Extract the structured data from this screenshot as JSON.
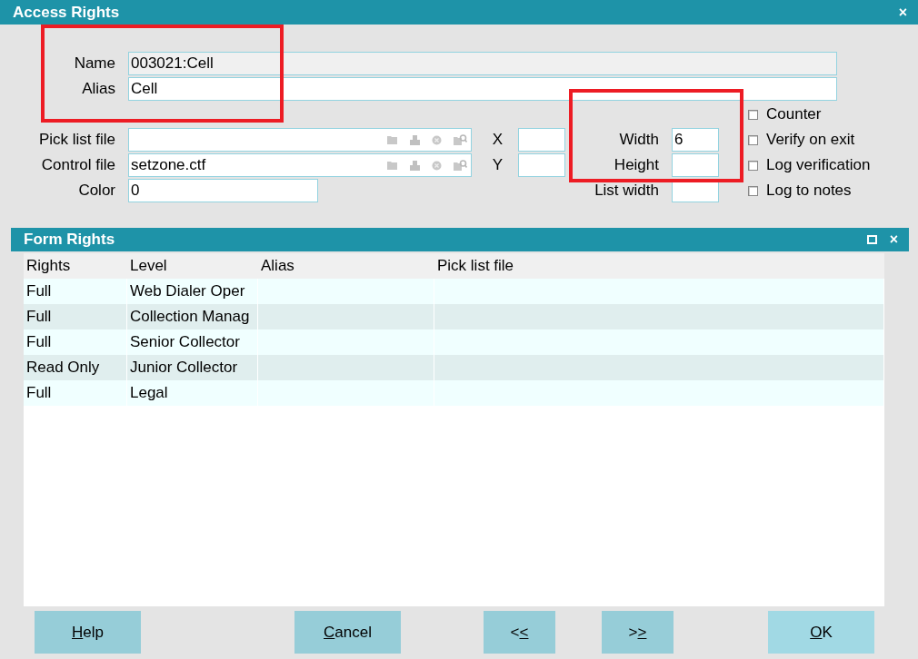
{
  "window": {
    "title": "Access Rights",
    "close": "×"
  },
  "name": {
    "label": "Name",
    "value": "003021:Cell",
    "readonly": true
  },
  "alias": {
    "label": "Alias",
    "value": "Cell",
    "readonly": false
  },
  "pick_list_file": {
    "label": "Pick list file"
  },
  "control_file": {
    "label": "Control file",
    "value": "setzone.ctf"
  },
  "color": {
    "label": "Color",
    "value": "0"
  },
  "x": {
    "label": "X"
  },
  "y": {
    "label": "Y"
  },
  "width": {
    "label": "Width",
    "value": "6"
  },
  "height": {
    "label": "Height"
  },
  "list_width": {
    "label": "List width"
  },
  "options": [
    {
      "label": "Counter",
      "checked": false
    },
    {
      "label": "Verify on exit",
      "checked": false
    },
    {
      "label": "Log verification",
      "checked": false
    },
    {
      "label": "Log to notes",
      "checked": false
    }
  ],
  "form_rights": {
    "title": "Form Rights",
    "close": "×",
    "columns": [
      "Rights",
      "Level",
      "Alias",
      "Pick list file"
    ],
    "rows": [
      [
        "Full",
        "Web Dialer Oper",
        null,
        null
      ],
      [
        "Full",
        "Collection Manag",
        null,
        null
      ],
      [
        "Full",
        "Senior Collector",
        null,
        null
      ],
      [
        "Read Only",
        "Junior Collector",
        null,
        null
      ],
      [
        "Full",
        "Legal",
        null,
        null
      ]
    ]
  },
  "buttons": [
    {
      "key": "H",
      "rest": "elp",
      "kind": "help"
    },
    {
      "key": "C",
      "rest": "ancel",
      "kind": "cancel"
    },
    {
      "lead": "<",
      "key": "<",
      "kind": "nav"
    },
    {
      "lead": ">",
      "key": ">",
      "kind": "nav"
    },
    {
      "key": "O",
      "rest": "K",
      "kind": "ok"
    }
  ]
}
